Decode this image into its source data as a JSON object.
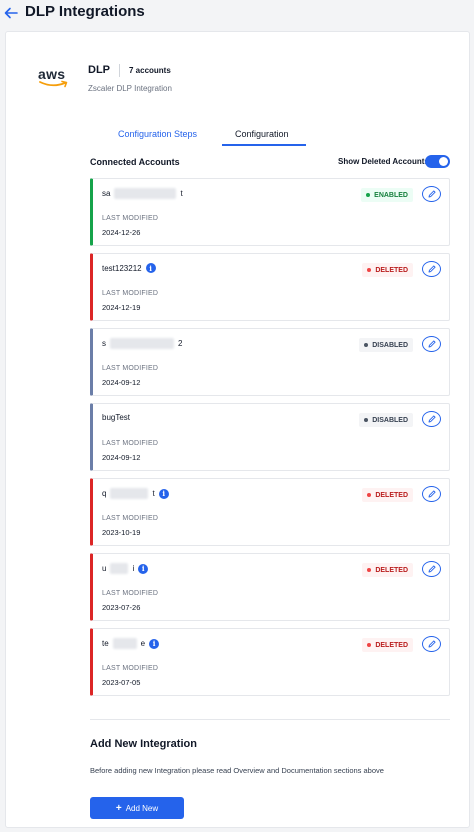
{
  "page": {
    "title": "DLP Integrations"
  },
  "integration": {
    "logo_text": "aws",
    "name": "DLP",
    "accounts_count": "7 accounts",
    "description": "Zscaler DLP Integration"
  },
  "tabs": [
    {
      "label": "Configuration Steps",
      "active": false
    },
    {
      "label": "Configuration",
      "active": true
    }
  ],
  "connected": {
    "title": "Connected Accounts",
    "show_deleted_label": "Show Deleted Accounts:",
    "show_deleted": true,
    "last_modified_label": "LAST MODIFIED"
  },
  "accounts": [
    {
      "name_start": "sa",
      "name_end": "t",
      "status": "ENABLED",
      "status_kind": "enabled",
      "date": "2024-12-26",
      "info": false
    },
    {
      "name_start": "test123212",
      "name_end": "",
      "status": "DELETED",
      "status_kind": "deleted",
      "date": "2024-12-19",
      "info": true
    },
    {
      "name_start": "s",
      "name_end": "2",
      "status": "DISABLED",
      "status_kind": "disabled",
      "date": "2024-09-12",
      "info": false
    },
    {
      "name_start": "bugTest",
      "name_end": "",
      "status": "DISABLED",
      "status_kind": "disabled",
      "date": "2024-09-12",
      "info": false
    },
    {
      "name_start": "q",
      "name_end": "t",
      "status": "DELETED",
      "status_kind": "deleted",
      "date": "2023-10-19",
      "info": true
    },
    {
      "name_start": "u",
      "name_end": "i",
      "status": "DELETED",
      "status_kind": "deleted",
      "date": "2023-07-26",
      "info": true
    },
    {
      "name_start": "te",
      "name_end": "e",
      "status": "DELETED",
      "status_kind": "deleted",
      "date": "2023-07-05",
      "info": true
    }
  ],
  "add": {
    "title": "Add New Integration",
    "description": "Before adding new Integration please read Overview and Documentation sections above",
    "button_label": "Add New"
  },
  "colors": {
    "accent": "#2563eb",
    "enabled": "#16a34a",
    "deleted": "#dc2626",
    "disabled": "#6b7ea8"
  }
}
